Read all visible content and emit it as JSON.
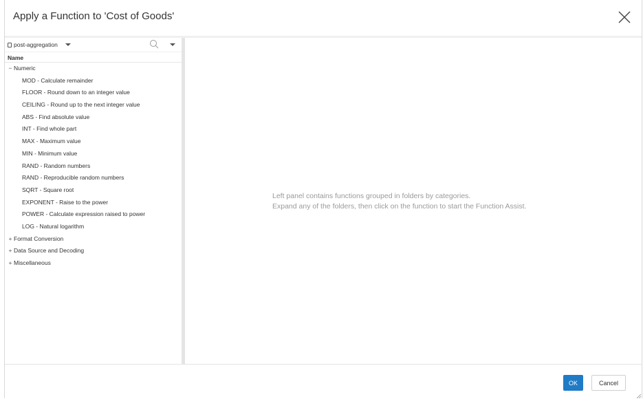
{
  "dialog": {
    "title": "Apply a Function to 'Cost of Goods'"
  },
  "toolbar": {
    "source_selected": "post-aggregation"
  },
  "tree": {
    "column_header": "Name",
    "folders": [
      {
        "label": "Numeric",
        "expanded": true,
        "functions": [
          "MOD - Calculate remainder",
          "FLOOR - Round down to an integer value",
          "CEILING - Round up to the next integer value",
          "ABS - Find absolute value",
          "INT - Find whole part",
          "MAX - Maximum value",
          "MIN - Minimum value",
          "RAND - Random numbers",
          "RAND - Reproducible random numbers",
          "SQRT - Square root",
          "EXPONENT - Raise to the power",
          "POWER - Calculate expression raised to power",
          "LOG - Natural logarithm"
        ]
      },
      {
        "label": "Format Conversion",
        "expanded": false
      },
      {
        "label": "Data Source and Decoding",
        "expanded": false
      },
      {
        "label": "Miscellaneous",
        "expanded": false
      }
    ]
  },
  "hint": {
    "line1": "Left panel contains functions grouped in folders by categories.",
    "line2": "Expand any of the folders, then click on the function to start the Function Assist."
  },
  "footer": {
    "ok_label": "OK",
    "cancel_label": "Cancel"
  },
  "colors": {
    "accent": "#1f7bc6",
    "hint_text": "#9a9a9a"
  }
}
